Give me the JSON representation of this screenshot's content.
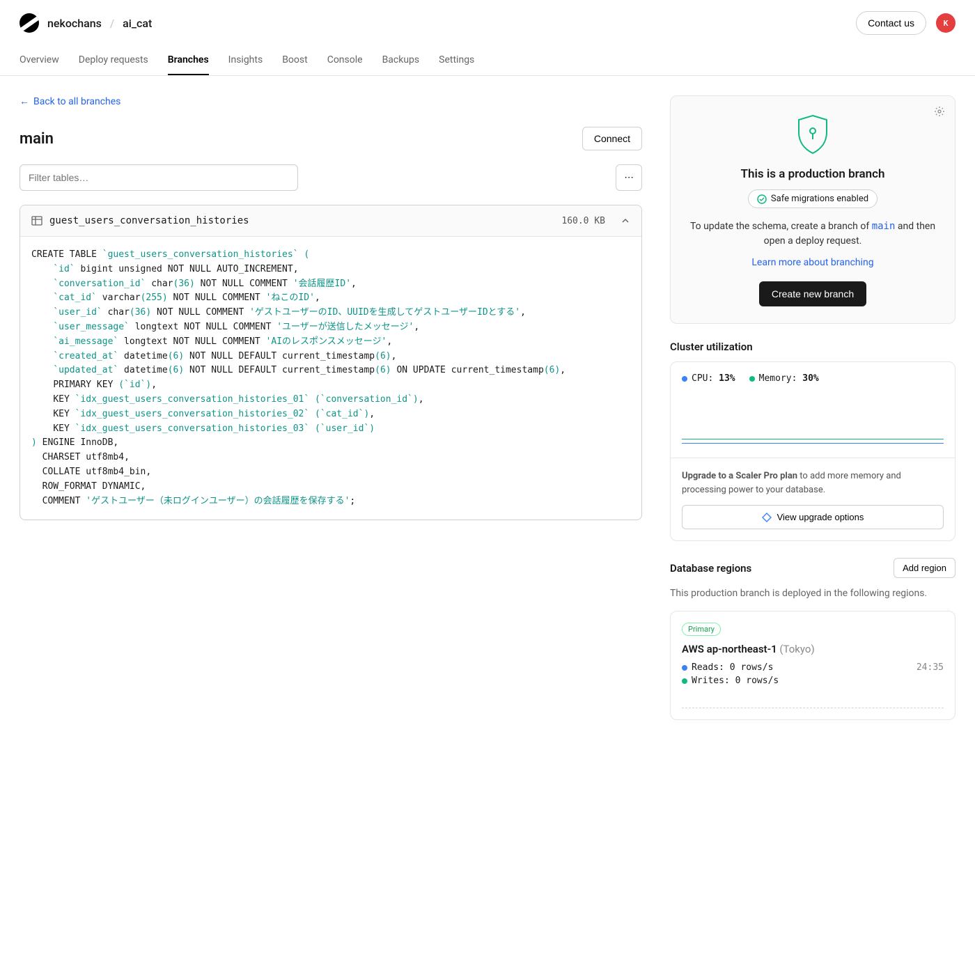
{
  "header": {
    "org": "nekochans",
    "project": "ai_cat",
    "contact": "Contact us",
    "avatar_initial": "K"
  },
  "tabs": [
    "Overview",
    "Deploy requests",
    "Branches",
    "Insights",
    "Boost",
    "Console",
    "Backups",
    "Settings"
  ],
  "active_tab": 2,
  "back_link": "Back to all branches",
  "branch_name": "main",
  "connect_btn": "Connect",
  "filter_placeholder": "Filter tables…",
  "table": {
    "name": "guest_users_conversation_histories",
    "size": "160.0 KB"
  },
  "production": {
    "title": "This is a production branch",
    "badge": "Safe migrations enabled",
    "text1": "To update the schema, create a branch of ",
    "text1_code": "main",
    "text1_rest": " and then open a deploy request.",
    "learn_more": "Learn more about branching",
    "create_btn": "Create new branch"
  },
  "cluster": {
    "title": "Cluster utilization",
    "cpu_label": "CPU: ",
    "cpu_value": "13%",
    "mem_label": "Memory: ",
    "mem_value": "30%",
    "upgrade_strong": "Upgrade to a Scaler Pro plan",
    "upgrade_rest": " to add more memory and processing power to your database.",
    "view_btn": "View upgrade options"
  },
  "regions": {
    "title": "Database regions",
    "add_btn": "Add region",
    "desc": "This production branch is deployed in the following regions.",
    "primary_label": "Primary",
    "region_name": "AWS ap-northeast-1",
    "region_loc": " (Tokyo)",
    "reads": "Reads:  0 rows/s",
    "writes": "Writes: 0 rows/s",
    "time": "24:35"
  },
  "chart_data": {
    "type": "line",
    "series": [
      {
        "name": "CPU",
        "color": "#3b82f6",
        "value_pct": 13
      },
      {
        "name": "Memory",
        "color": "#10b981",
        "value_pct": 30
      }
    ],
    "ylim": [
      0,
      100
    ]
  }
}
